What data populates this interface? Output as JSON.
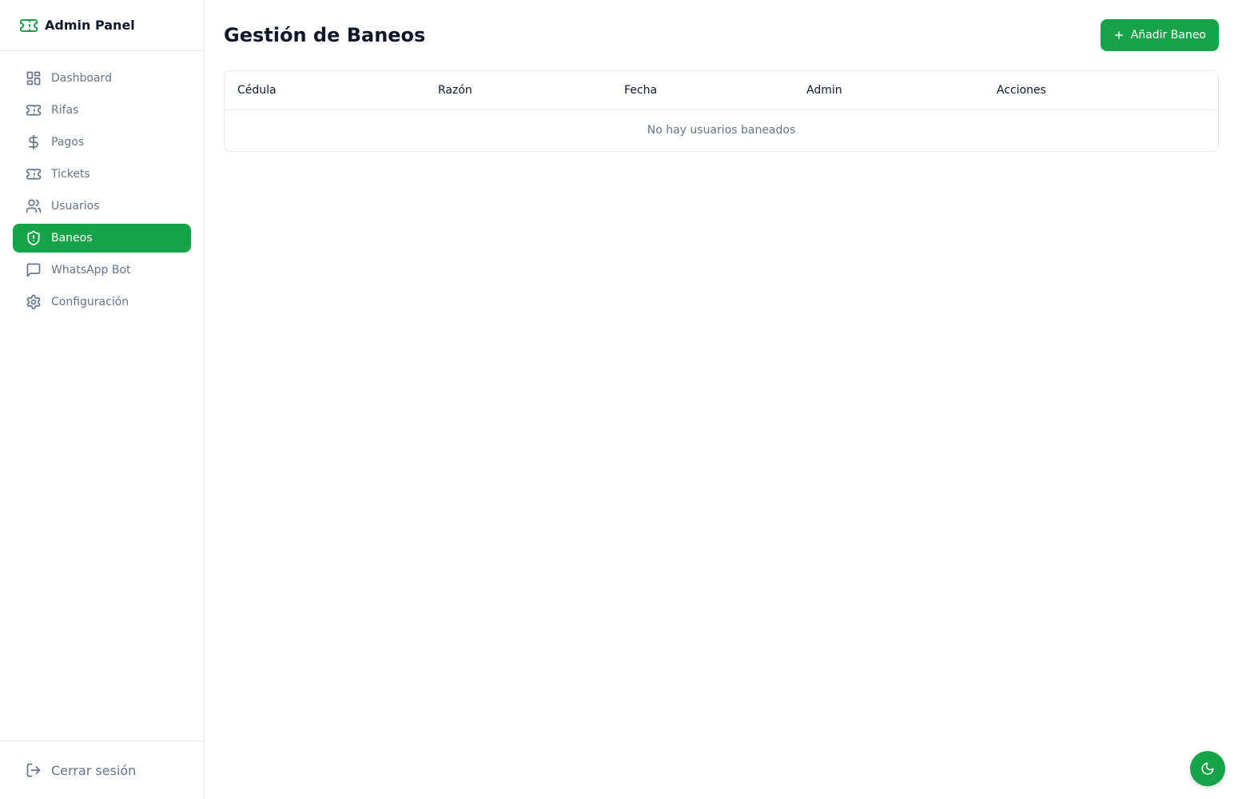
{
  "brand": {
    "title": "Admin Panel",
    "icon": "ticket-icon"
  },
  "sidebar": {
    "items": [
      {
        "label": "Dashboard",
        "icon": "dashboard-icon",
        "active": false
      },
      {
        "label": "Rifas",
        "icon": "ticket-icon",
        "active": false
      },
      {
        "label": "Pagos",
        "icon": "dollar-icon",
        "active": false
      },
      {
        "label": "Tickets",
        "icon": "ticket-icon",
        "active": false
      },
      {
        "label": "Usuarios",
        "icon": "users-icon",
        "active": false
      },
      {
        "label": "Baneos",
        "icon": "shield-alert-icon",
        "active": true
      },
      {
        "label": "WhatsApp Bot",
        "icon": "message-square-icon",
        "active": false
      },
      {
        "label": "Configuración",
        "icon": "gear-icon",
        "active": false
      }
    ],
    "logout_label": "Cerrar sesión"
  },
  "main": {
    "title": "Gestión de Baneos",
    "add_button_label": "Añadir Baneo",
    "table": {
      "columns": [
        "Cédula",
        "Razón",
        "Fecha",
        "Admin",
        "Acciones"
      ],
      "empty_message": "No hay usuarios baneados"
    }
  },
  "colors": {
    "accent": "#16a34a",
    "muted": "#64748b",
    "border": "#e5e7eb"
  }
}
